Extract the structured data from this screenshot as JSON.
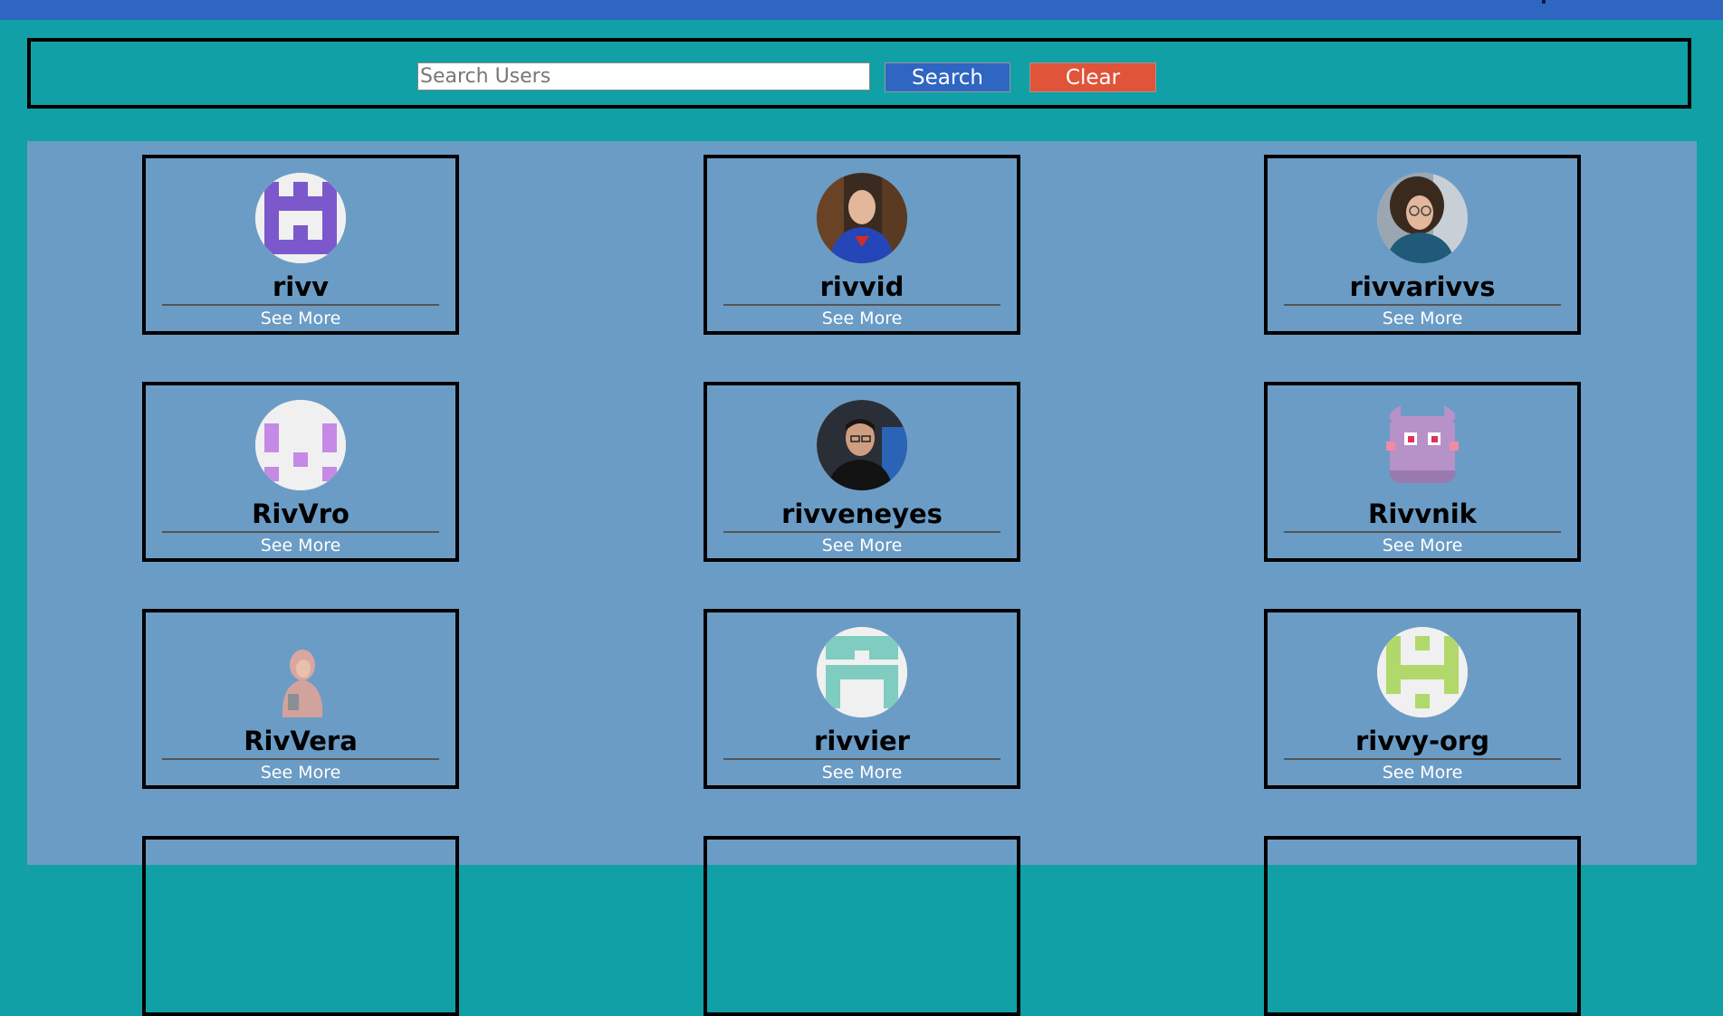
{
  "search": {
    "placeholder": "Search Users",
    "value": "",
    "search_label": "Search",
    "clear_label": "Clear"
  },
  "colors": {
    "header": "#2f66c2",
    "page_background": "#10a0a6",
    "results_background": "#6b9cc5",
    "search_button": "#2f66c2",
    "clear_button": "#e0543a"
  },
  "users": [
    {
      "name": "rivv",
      "link_label": "See More",
      "avatar": "identicon-purple"
    },
    {
      "name": "rivvid",
      "link_label": "See More",
      "avatar": "photo-superman-shirt"
    },
    {
      "name": "rivvarivvs",
      "link_label": "See More",
      "avatar": "photo-woman-glasses"
    },
    {
      "name": "RivVro",
      "link_label": "See More",
      "avatar": "identicon-lilac"
    },
    {
      "name": "rivveneyes",
      "link_label": "See More",
      "avatar": "photo-man-glasses"
    },
    {
      "name": "Rivvnik",
      "link_label": "See More",
      "avatar": "pixel-purple-creature"
    },
    {
      "name": "RivVera",
      "link_label": "See More",
      "avatar": "photo-woman-hijab"
    },
    {
      "name": "rivvier",
      "link_label": "See More",
      "avatar": "identicon-teal"
    },
    {
      "name": "rivvy-org",
      "link_label": "See More",
      "avatar": "identicon-lime"
    }
  ]
}
